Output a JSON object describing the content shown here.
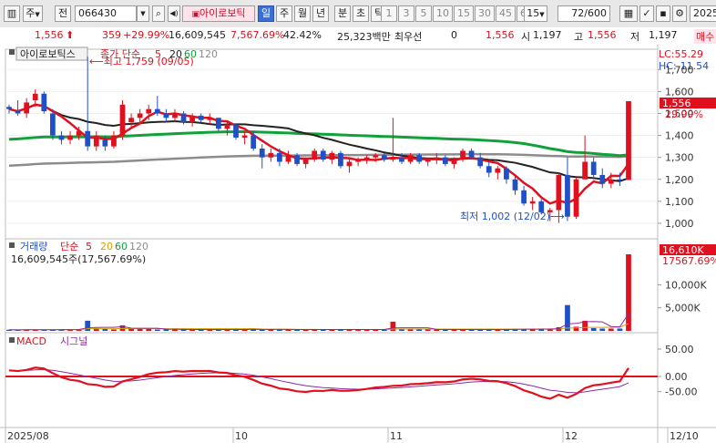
{
  "toolbar": {
    "market": "주",
    "scope": "전",
    "code": "066430",
    "name": "아이로보틱",
    "periods": [
      "일",
      "주",
      "월",
      "년",
      "분",
      "초",
      "틱"
    ],
    "active_period": "일",
    "numbers": [
      "1",
      "3",
      "5",
      "10",
      "15",
      "30",
      "45",
      "60"
    ],
    "custom": "15",
    "count": "72/600",
    "date": "2025/"
  },
  "quote": {
    "price": "1,556",
    "change": "359",
    "change_pct": "+29.99%",
    "volume": "16,609,545",
    "vol_ratio": "7,567.69%",
    "turnover": "42.42%",
    "amount": "25,323백만",
    "best_ask_label": "최우선",
    "best_ask": "0",
    "best_price": "1,556",
    "open_label": "시",
    "open": "1,197",
    "high_label": "고",
    "high": "1,556",
    "low_label": "저",
    "low": "1,197",
    "side_label": "매수"
  },
  "price_panel": {
    "name_tag": "아이로보틱스",
    "legend_title": "종가 단순",
    "ma_labels": [
      "5",
      "20",
      "60",
      "120"
    ],
    "ma_colors": [
      "#e0101e",
      "#222222",
      "#11a13a",
      "#8c8c8c"
    ],
    "lc": "LC:55.29",
    "hc": "HC:-11.54",
    "last_price": "1,556",
    "last_pct": "29.99%",
    "high_note": "최고 1,759 (09/05)",
    "low_note": "최저 1,002 (12/02)",
    "y_ticks": [
      "1,700",
      "1,600",
      "1,500",
      "1,400",
      "1,300",
      "1,200",
      "1,100",
      "1,000"
    ]
  },
  "volume_panel": {
    "title": "거래량",
    "legend_title": "단순",
    "ma_labels": [
      "5",
      "20",
      "60",
      "120"
    ],
    "value_line": "16,609,545주(17,567.69%)",
    "last_label": "16,610K",
    "last_pct": "17567.69%",
    "y_ticks": [
      "10,000K",
      "5,000K"
    ]
  },
  "macd_panel": {
    "title": "MACD",
    "signal_label": "시그널",
    "y_ticks": [
      "50.00",
      "0.00",
      "-50.00"
    ]
  },
  "x_axis": {
    "labels": [
      "2025/08",
      "10",
      "11",
      "12",
      "12/10"
    ]
  },
  "chart_data": {
    "type": "candlestick",
    "x_labels": [
      "2025/08",
      "10",
      "11",
      "12"
    ],
    "ylim": [
      950,
      1780
    ],
    "candles": [
      [
        1530,
        1540,
        1500,
        1520
      ],
      [
        1515,
        1560,
        1490,
        1500
      ],
      [
        1500,
        1570,
        1480,
        1550
      ],
      [
        1560,
        1610,
        1530,
        1590
      ],
      [
        1590,
        1600,
        1500,
        1510
      ],
      [
        1500,
        1520,
        1380,
        1400
      ],
      [
        1400,
        1420,
        1360,
        1380
      ],
      [
        1380,
        1420,
        1360,
        1400
      ],
      [
        1400,
        1440,
        1380,
        1420
      ],
      [
        1420,
        1759,
        1330,
        1350
      ],
      [
        1350,
        1420,
        1330,
        1400
      ],
      [
        1380,
        1400,
        1330,
        1350
      ],
      [
        1350,
        1420,
        1340,
        1400
      ],
      [
        1400,
        1560,
        1380,
        1540
      ],
      [
        1460,
        1500,
        1440,
        1480
      ],
      [
        1480,
        1520,
        1460,
        1500
      ],
      [
        1500,
        1540,
        1470,
        1520
      ],
      [
        1520,
        1580,
        1490,
        1500
      ],
      [
        1500,
        1520,
        1460,
        1480
      ],
      [
        1480,
        1520,
        1460,
        1500
      ],
      [
        1500,
        1510,
        1450,
        1460
      ],
      [
        1460,
        1500,
        1440,
        1490
      ],
      [
        1490,
        1500,
        1460,
        1470
      ],
      [
        1470,
        1500,
        1450,
        1480
      ],
      [
        1480,
        1480,
        1420,
        1430
      ],
      [
        1430,
        1460,
        1400,
        1450
      ],
      [
        1450,
        1450,
        1380,
        1390
      ],
      [
        1390,
        1420,
        1360,
        1400
      ],
      [
        1400,
        1420,
        1330,
        1340
      ],
      [
        1340,
        1360,
        1250,
        1300
      ],
      [
        1300,
        1340,
        1280,
        1320
      ],
      [
        1320,
        1340,
        1260,
        1280
      ],
      [
        1280,
        1330,
        1270,
        1310
      ],
      [
        1310,
        1320,
        1260,
        1270
      ],
      [
        1270,
        1300,
        1250,
        1290
      ],
      [
        1290,
        1340,
        1280,
        1330
      ],
      [
        1330,
        1340,
        1280,
        1290
      ],
      [
        1290,
        1330,
        1270,
        1320
      ],
      [
        1320,
        1330,
        1250,
        1260
      ],
      [
        1260,
        1290,
        1230,
        1280
      ],
      [
        1280,
        1300,
        1260,
        1290
      ],
      [
        1290,
        1310,
        1270,
        1300
      ],
      [
        1300,
        1320,
        1280,
        1310
      ],
      [
        1310,
        1320,
        1280,
        1290
      ],
      [
        1290,
        1480,
        1280,
        1300
      ],
      [
        1300,
        1320,
        1270,
        1280
      ],
      [
        1280,
        1320,
        1270,
        1310
      ],
      [
        1310,
        1320,
        1270,
        1280
      ],
      [
        1280,
        1300,
        1260,
        1290
      ],
      [
        1290,
        1320,
        1270,
        1300
      ],
      [
        1300,
        1310,
        1260,
        1270
      ],
      [
        1270,
        1300,
        1250,
        1290
      ],
      [
        1290,
        1340,
        1280,
        1330
      ],
      [
        1330,
        1340,
        1290,
        1300
      ],
      [
        1300,
        1320,
        1250,
        1260
      ],
      [
        1260,
        1280,
        1210,
        1230
      ],
      [
        1230,
        1260,
        1200,
        1250
      ],
      [
        1250,
        1260,
        1180,
        1200
      ],
      [
        1200,
        1220,
        1130,
        1150
      ],
      [
        1150,
        1170,
        1080,
        1090
      ],
      [
        1090,
        1120,
        1060,
        1100
      ],
      [
        1100,
        1110,
        1040,
        1050
      ],
      [
        1050,
        1070,
        1010,
        1060
      ],
      [
        1060,
        1230,
        1002,
        1220
      ],
      [
        1220,
        1300,
        1010,
        1030
      ],
      [
        1030,
        1210,
        1020,
        1200
      ],
      [
        1200,
        1400,
        1200,
        1280
      ],
      [
        1280,
        1300,
        1200,
        1220
      ],
      [
        1220,
        1250,
        1160,
        1180
      ],
      [
        1180,
        1230,
        1160,
        1200
      ],
      [
        1200,
        1230,
        1170,
        1197
      ],
      [
        1197,
        1556,
        1197,
        1556
      ]
    ],
    "volume": [
      0.25,
      0.2,
      0.3,
      0.2,
      0.25,
      0.3,
      0.3,
      0.3,
      0.3,
      2.2,
      0.6,
      0.4,
      0.3,
      1.2,
      0.5,
      0.4,
      0.4,
      0.3,
      0.3,
      0.3,
      0.3,
      0.3,
      0.3,
      0.3,
      0.3,
      0.3,
      0.3,
      0.3,
      0.4,
      0.3,
      0.3,
      0.3,
      0.3,
      0.3,
      0.3,
      0.3,
      0.3,
      0.3,
      0.3,
      0.3,
      0.3,
      0.3,
      0.3,
      0.3,
      2.0,
      0.4,
      0.3,
      0.3,
      0.3,
      0.3,
      0.3,
      0.3,
      0.3,
      0.3,
      0.3,
      0.3,
      0.3,
      0.3,
      0.4,
      0.4,
      0.4,
      0.4,
      0.4,
      0.8,
      5.6,
      0.9,
      2.2,
      0.6,
      0.5,
      0.5,
      0.5,
      16.61
    ],
    "volume_ylim": [
      0,
      16.61
    ]
  }
}
